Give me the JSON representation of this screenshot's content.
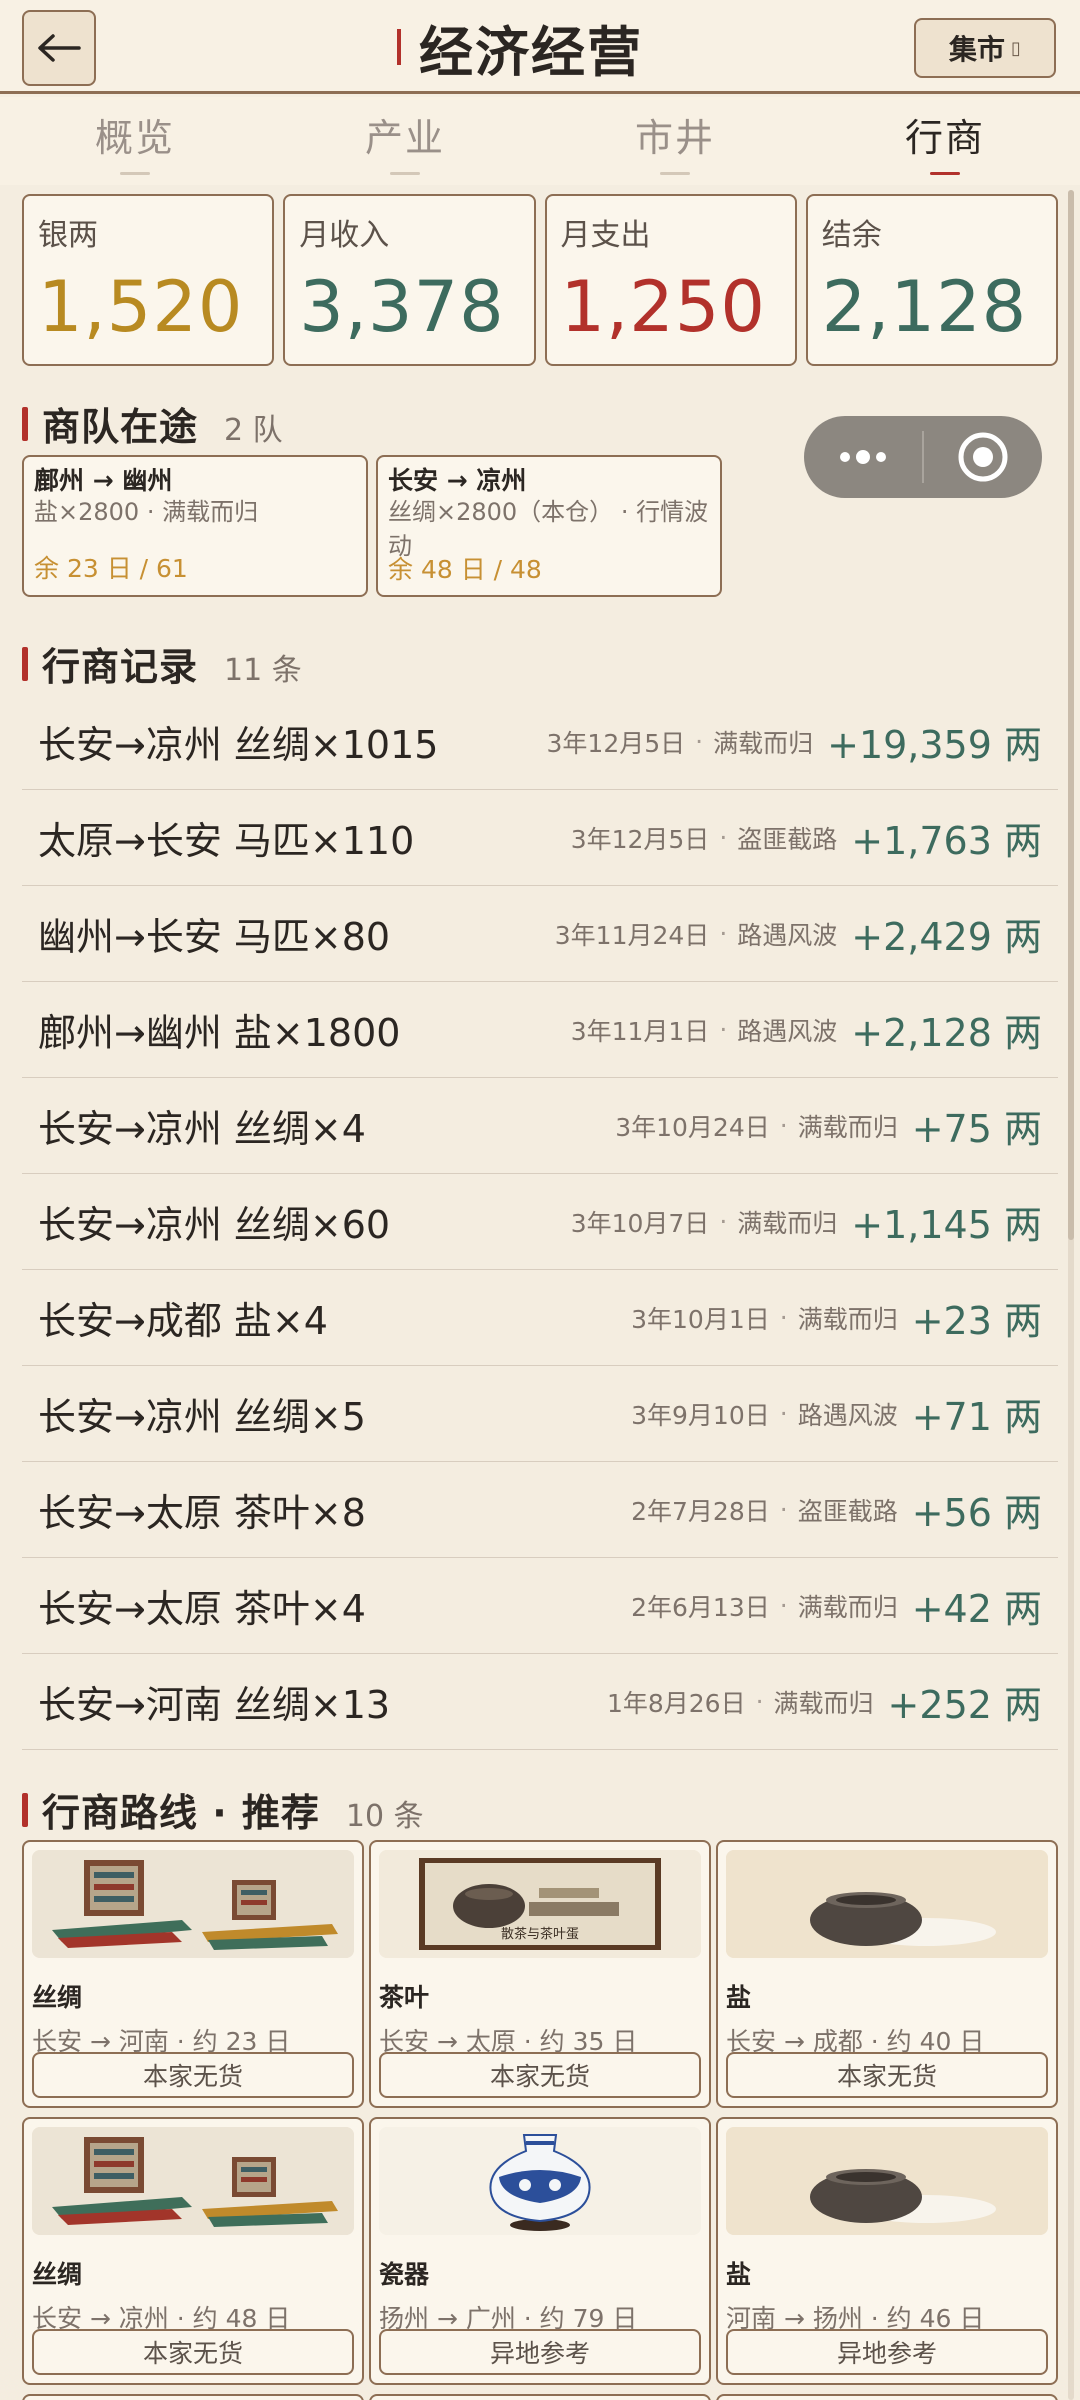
{
  "header": {
    "title": "经济经营",
    "market_label": "集市",
    "market_glyph": "▯"
  },
  "tabs": [
    {
      "label": "概览",
      "active": false
    },
    {
      "label": "产业",
      "active": false
    },
    {
      "label": "市井",
      "active": false
    },
    {
      "label": "行商",
      "active": true
    }
  ],
  "stats": [
    {
      "label": "银两",
      "value": "1,520",
      "color": "#b88a21"
    },
    {
      "label": "月收入",
      "value": "3,378",
      "color": "#3d6b5e"
    },
    {
      "label": "月支出",
      "value": "1,250",
      "color": "#b2312b"
    },
    {
      "label": "结余",
      "value": "2,128",
      "color": "#3d6b5e"
    }
  ],
  "caravans_section": {
    "title": "商队在途",
    "count": "2 队"
  },
  "caravans": [
    {
      "route": "鄜州 → 幽州",
      "goods": "盐×2800 · 满载而归",
      "remain": "余 23 日 / 61"
    },
    {
      "route": "长安 → 凉州",
      "goods": "丝绸×2800（本仓） · 行情波动",
      "remain": "余 48 日 / 48"
    }
  ],
  "records_section": {
    "title": "行商记录",
    "count": "11 条"
  },
  "records": [
    {
      "title": "长安→凉州 丝绸×1015",
      "date": "3年12月5日",
      "event": "满载而归",
      "amount": "+19,359 两"
    },
    {
      "title": "太原→长安 马匹×110",
      "date": "3年12月5日",
      "event": "盗匪截路",
      "amount": "+1,763 两"
    },
    {
      "title": "幽州→长安 马匹×80",
      "date": "3年11月24日",
      "event": "路遇风波",
      "amount": "+2,429 两"
    },
    {
      "title": "鄜州→幽州 盐×1800",
      "date": "3年11月1日",
      "event": "路遇风波",
      "amount": "+2,128 两"
    },
    {
      "title": "长安→凉州 丝绸×4",
      "date": "3年10月24日",
      "event": "满载而归",
      "amount": "+75 两"
    },
    {
      "title": "长安→凉州 丝绸×60",
      "date": "3年10月7日",
      "event": "满载而归",
      "amount": "+1,145 两"
    },
    {
      "title": "长安→成都 盐×4",
      "date": "3年10月1日",
      "event": "满载而归",
      "amount": "+23 两"
    },
    {
      "title": "长安→凉州 丝绸×5",
      "date": "3年9月10日",
      "event": "路遇风波",
      "amount": "+71 两"
    },
    {
      "title": "长安→太原 茶叶×8",
      "date": "2年7月28日",
      "event": "盗匪截路",
      "amount": "+56 两"
    },
    {
      "title": "长安→太原 茶叶×4",
      "date": "2年6月13日",
      "event": "满载而归",
      "amount": "+42 两"
    },
    {
      "title": "长安→河南 丝绸×13",
      "date": "1年8月26日",
      "event": "满载而归",
      "amount": "+252 两"
    }
  ],
  "routes_section": {
    "title": "行商路线 · 推荐",
    "count": "10 条"
  },
  "routes": [
    {
      "goods": "丝绸",
      "path": "长安 → 河南 · 约 23 日",
      "button": "本家无货",
      "image": "silk-icon"
    },
    {
      "goods": "茶叶",
      "path": "长安 → 太原 · 约 35 日",
      "button": "本家无货",
      "image": "tea-icon",
      "image_caption": "散茶与茶叶蛋"
    },
    {
      "goods": "盐",
      "path": "长安 → 成都 · 约 40 日",
      "button": "本家无货",
      "image": "salt-icon"
    },
    {
      "goods": "丝绸",
      "path": "长安 → 凉州 · 约 48 日",
      "button": "本家无货",
      "image": "silk-icon"
    },
    {
      "goods": "瓷器",
      "path": "扬州 → 广州 · 约 79 日",
      "button": "异地参考",
      "image": "porcelain-icon"
    },
    {
      "goods": "盐",
      "path": "河南 → 扬州 · 约 46 日",
      "button": "异地参考",
      "image": "salt-icon"
    }
  ]
}
